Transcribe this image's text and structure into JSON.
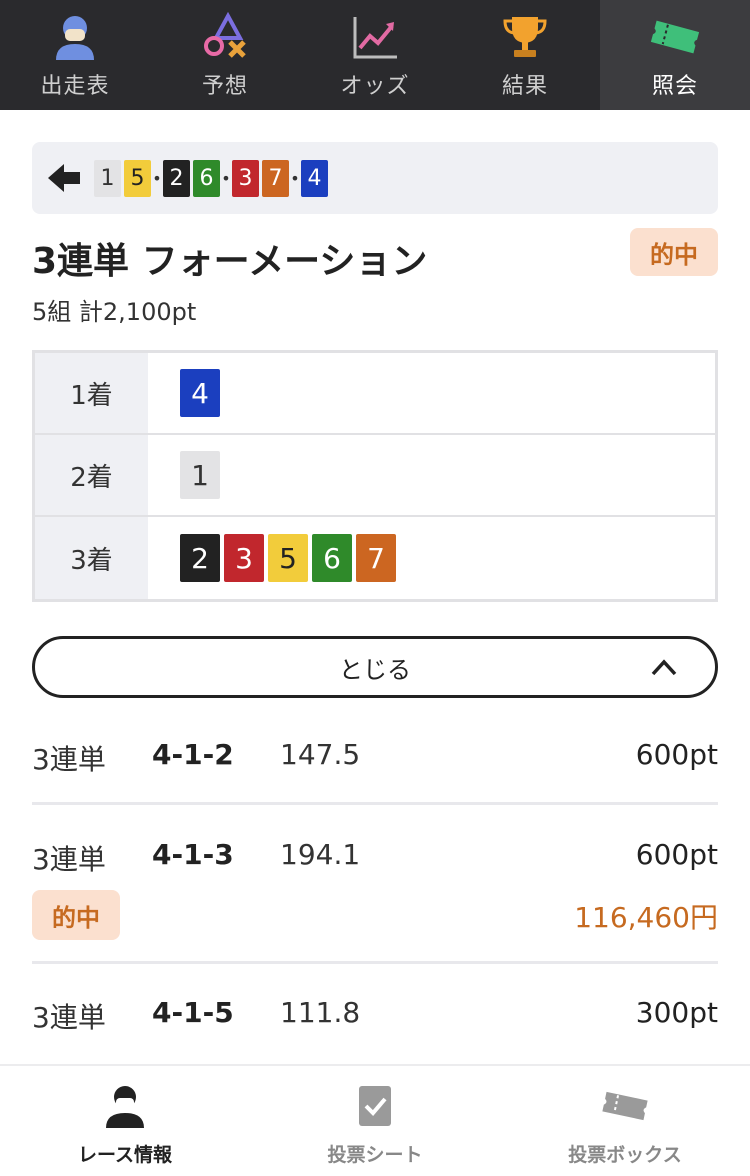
{
  "top_nav": {
    "tabs": [
      {
        "label": "出走表",
        "icon": "jockey-icon",
        "active": false
      },
      {
        "label": "予想",
        "icon": "prediction-icon",
        "active": false
      },
      {
        "label": "オッズ",
        "icon": "odds-chart-icon",
        "active": false
      },
      {
        "label": "結果",
        "icon": "trophy-icon",
        "active": false
      },
      {
        "label": "照会",
        "icon": "ticket-icon",
        "active": true
      }
    ]
  },
  "combo_bar": {
    "first": [
      "1",
      "5"
    ],
    "second": [
      "2",
      "6"
    ],
    "third": [
      "3",
      "7"
    ],
    "fourth": [
      "4"
    ],
    "separator": "•"
  },
  "bet": {
    "title": "3連単 フォーメーション",
    "status_badge": "的中",
    "summary": "5組 計2,100pt"
  },
  "formation": {
    "rows": [
      {
        "label": "1着",
        "numbers": [
          "4"
        ]
      },
      {
        "label": "2着",
        "numbers": [
          "1"
        ]
      },
      {
        "label": "3着",
        "numbers": [
          "2",
          "3",
          "5",
          "6",
          "7"
        ]
      }
    ]
  },
  "close_button": {
    "label": "とじる"
  },
  "results": [
    {
      "type": "3連単",
      "combo": "4-1-2",
      "odds": "147.5",
      "amount": "600pt"
    },
    {
      "type": "3連単",
      "combo": "4-1-3",
      "odds": "194.1",
      "amount": "600pt",
      "hit_badge": "的中",
      "payout": "116,460円"
    },
    {
      "type": "3連単",
      "combo": "4-1-5",
      "odds": "111.8",
      "amount": "300pt"
    }
  ],
  "bottom_nav": {
    "tabs": [
      {
        "label": "レース情報",
        "icon": "jockey-icon",
        "active": true
      },
      {
        "label": "投票シート",
        "icon": "check-sheet-icon",
        "active": false
      },
      {
        "label": "投票ボックス",
        "icon": "ticket-icon",
        "active": false
      }
    ]
  },
  "colors": {
    "boat_1": "#e3e3e5",
    "boat_2": "#222222",
    "boat_3": "#c1272d",
    "boat_4": "#1b3fbf",
    "boat_5": "#f2cc3b",
    "boat_6": "#2f8a2a",
    "boat_7": "#cc6621",
    "hit": "#c66a20",
    "hit_bg": "#fbe0cf",
    "nav_bg": "#2a2a2d"
  }
}
